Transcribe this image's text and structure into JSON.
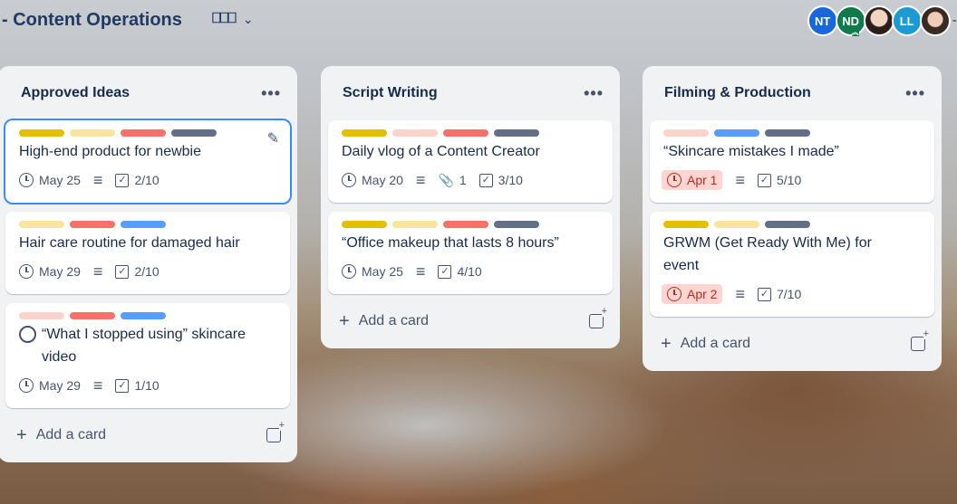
{
  "board": {
    "title": "- Content Operations",
    "view_icon": "board-icon",
    "chevron": "⌄"
  },
  "members": [
    {
      "initials": "NT",
      "color": "#1868db"
    },
    {
      "initials": "ND",
      "color": "#0f7a4a"
    },
    {
      "initials": "",
      "color": "#2b1f1c"
    },
    {
      "initials": "LL",
      "color": "#1d9bd1"
    },
    {
      "initials": "",
      "color": "#3a2a24"
    }
  ],
  "colors": {
    "yellow": "#e2c000",
    "light_yellow": "#f8e6a0",
    "light_red": "#ffd2cc",
    "red": "#f87168",
    "gray": "#626f86",
    "blue": "#579dff"
  },
  "lists": [
    {
      "title": "Approved Ideas",
      "menu": "•••",
      "add_label": "Add a card",
      "cards": [
        {
          "labels": [
            "#e2c000",
            "#f8e6a0",
            "#f87168",
            "#626f86"
          ],
          "title": "High-end product for newbie",
          "date": "May 25",
          "checklist": "2/10"
        },
        {
          "labels": [
            "#f8e6a0",
            "#f87168",
            "#579dff"
          ],
          "title": "Hair care routine for damaged hair",
          "date": "May 29",
          "checklist": "2/10"
        },
        {
          "labels": [
            "#ffd2cc",
            "#f87168",
            "#579dff"
          ],
          "title": "“What I stopped using” skincare video",
          "date": "May 29",
          "checklist": "1/10"
        }
      ]
    },
    {
      "title": "Script Writing",
      "menu": "•••",
      "add_label": "Add a card",
      "cards": [
        {
          "labels": [
            "#e2c000",
            "#ffd2cc",
            "#f87168",
            "#626f86"
          ],
          "title": "Daily vlog of a Content Creator",
          "date": "May 20",
          "attachments": "1",
          "checklist": "3/10"
        },
        {
          "labels": [
            "#e2c000",
            "#f8e6a0",
            "#f87168",
            "#626f86"
          ],
          "title": "“Office makeup that lasts 8 hours”",
          "date": "May 25",
          "checklist": "4/10"
        }
      ]
    },
    {
      "title": "Filming & Production",
      "menu": "•••",
      "add_label": "Add a card",
      "cards": [
        {
          "labels": [
            "#ffd2cc",
            "#579dff",
            "#626f86"
          ],
          "title": "“Skincare mistakes I made”",
          "date": "Apr 1",
          "checklist": "5/10"
        },
        {
          "labels": [
            "#e2c000",
            "#f8e6a0",
            "#626f86"
          ],
          "title": "GRWM (Get Ready With Me) for event",
          "date": "Apr 2",
          "checklist": "7/10"
        }
      ]
    }
  ]
}
